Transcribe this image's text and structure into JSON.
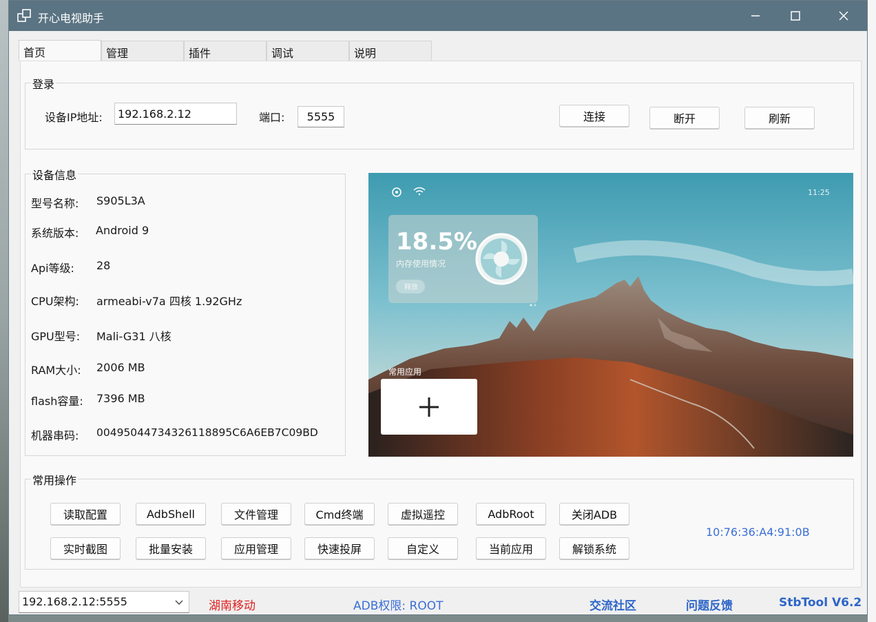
{
  "window": {
    "title": "开心电视助手"
  },
  "tabs": [
    {
      "label": "首页",
      "active": true
    },
    {
      "label": "管理",
      "active": false
    },
    {
      "label": "插件",
      "active": false
    },
    {
      "label": "调试",
      "active": false
    },
    {
      "label": "说明",
      "active": false
    }
  ],
  "login": {
    "group_title": "登录",
    "ip_label": "设备IP地址:",
    "ip_value": "192.168.2.12",
    "port_label": "端口:",
    "port_value": "5555",
    "connect_label": "连接",
    "disconnect_label": "断开",
    "refresh_label": "刷新"
  },
  "device": {
    "group_title": "设备信息",
    "rows": [
      {
        "label": "型号名称:",
        "value": "S905L3A"
      },
      {
        "label": "系统版本:",
        "value": "Android 9"
      },
      {
        "label": "Api等级:",
        "value": "28"
      },
      {
        "label": "CPU架构:",
        "value": "armeabi-v7a 四核 1.92GHz"
      },
      {
        "label": "GPU型号:",
        "value": "Mali-G31 八核"
      },
      {
        "label": "RAM大小:",
        "value": "2006 MB"
      },
      {
        "label": "flash容量:",
        "value": "7396 MB"
      },
      {
        "label": "机器串码:",
        "value": "0049504473432611889​5C6A6EB7C09BD"
      }
    ]
  },
  "screen": {
    "time": "11:25",
    "memory_percent": "18.5%",
    "memory_label": "内存使用情况",
    "release_label": "释放",
    "apps_label": "常用应用",
    "add_label": "+"
  },
  "operations": {
    "group_title": "常用操作",
    "row1": [
      "读取配置",
      "AdbShell",
      "文件管理",
      "Cmd终端",
      "虚拟遥控",
      "AdbRoot",
      "关闭ADB"
    ],
    "row2": [
      "实时截图",
      "批量安装",
      "应用管理",
      "快速投屏",
      "自定义",
      "当前应用",
      "解锁系统"
    ],
    "mac": "10:76:36:A4:91:0B"
  },
  "status": {
    "device_select": "192.168.2.12:5555",
    "isp": "湖南移动",
    "adb_permission": "ADB权限:  ROOT",
    "community": "交流社区",
    "feedback": "问题反馈",
    "version": "StbTool V6.2"
  },
  "colors": {
    "titlebar": "#5b7483",
    "link_blue": "#3b6fd6",
    "isp_red": "#e02020"
  }
}
